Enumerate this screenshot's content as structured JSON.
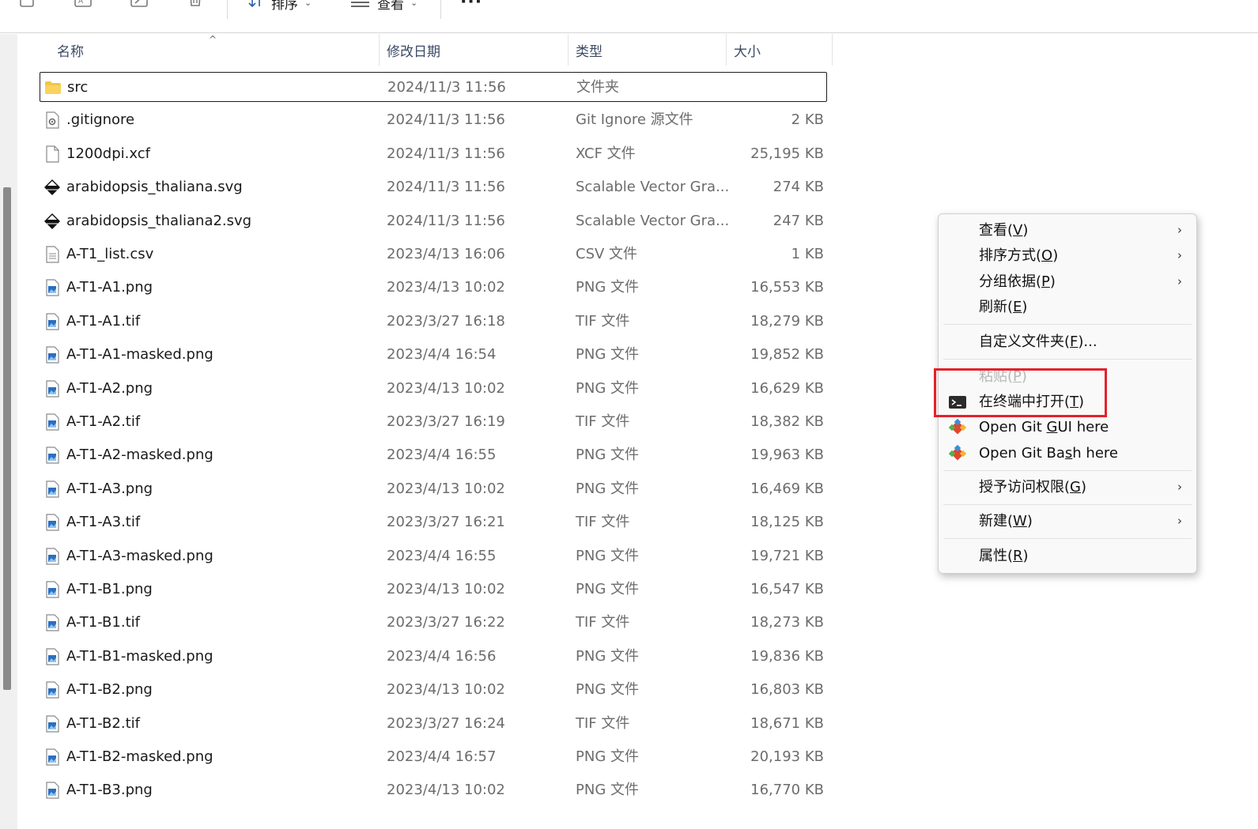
{
  "toolbar": {
    "sort_label": "排序",
    "view_label": "查看",
    "more_label": "···",
    "chevron": "⌄"
  },
  "columns": {
    "name": "名称",
    "date": "修改日期",
    "type": "类型",
    "size": "大小",
    "sort_indicator": "^"
  },
  "files": [
    {
      "name": "src",
      "date": "2024/11/3 11:56",
      "type": "文件夹",
      "size": "",
      "icon": "folder-icon",
      "selected": true
    },
    {
      "name": ".gitignore",
      "date": "2024/11/3 11:56",
      "type": "Git Ignore 源文件",
      "size": "2 KB",
      "icon": "config-file-icon"
    },
    {
      "name": "1200dpi.xcf",
      "date": "2024/11/3 11:56",
      "type": "XCF 文件",
      "size": "25,195 KB",
      "icon": "blank-file-icon"
    },
    {
      "name": "arabidopsis_thaliana.svg",
      "date": "2024/11/3 11:56",
      "type": "Scalable Vector Gra...",
      "size": "274 KB",
      "icon": "inkscape-icon"
    },
    {
      "name": "arabidopsis_thaliana2.svg",
      "date": "2024/11/3 11:56",
      "type": "Scalable Vector Gra...",
      "size": "247 KB",
      "icon": "inkscape-icon"
    },
    {
      "name": "A-T1_list.csv",
      "date": "2023/4/13 16:06",
      "type": "CSV 文件",
      "size": "1 KB",
      "icon": "text-file-icon"
    },
    {
      "name": "A-T1-A1.png",
      "date": "2023/4/13 10:02",
      "type": "PNG 文件",
      "size": "16,553 KB",
      "icon": "image-file-icon"
    },
    {
      "name": "A-T1-A1.tif",
      "date": "2023/3/27 16:18",
      "type": "TIF 文件",
      "size": "18,279 KB",
      "icon": "image-file-icon"
    },
    {
      "name": "A-T1-A1-masked.png",
      "date": "2023/4/4 16:54",
      "type": "PNG 文件",
      "size": "19,852 KB",
      "icon": "image-file-icon"
    },
    {
      "name": "A-T1-A2.png",
      "date": "2023/4/13 10:02",
      "type": "PNG 文件",
      "size": "16,629 KB",
      "icon": "image-file-icon"
    },
    {
      "name": "A-T1-A2.tif",
      "date": "2023/3/27 16:19",
      "type": "TIF 文件",
      "size": "18,382 KB",
      "icon": "image-file-icon"
    },
    {
      "name": "A-T1-A2-masked.png",
      "date": "2023/4/4 16:55",
      "type": "PNG 文件",
      "size": "19,963 KB",
      "icon": "image-file-icon"
    },
    {
      "name": "A-T1-A3.png",
      "date": "2023/4/13 10:02",
      "type": "PNG 文件",
      "size": "16,469 KB",
      "icon": "image-file-icon"
    },
    {
      "name": "A-T1-A3.tif",
      "date": "2023/3/27 16:21",
      "type": "TIF 文件",
      "size": "18,125 KB",
      "icon": "image-file-icon"
    },
    {
      "name": "A-T1-A3-masked.png",
      "date": "2023/4/4 16:55",
      "type": "PNG 文件",
      "size": "19,721 KB",
      "icon": "image-file-icon"
    },
    {
      "name": "A-T1-B1.png",
      "date": "2023/4/13 10:02",
      "type": "PNG 文件",
      "size": "16,547 KB",
      "icon": "image-file-icon"
    },
    {
      "name": "A-T1-B1.tif",
      "date": "2023/3/27 16:22",
      "type": "TIF 文件",
      "size": "18,273 KB",
      "icon": "image-file-icon"
    },
    {
      "name": "A-T1-B1-masked.png",
      "date": "2023/4/4 16:56",
      "type": "PNG 文件",
      "size": "19,836 KB",
      "icon": "image-file-icon"
    },
    {
      "name": "A-T1-B2.png",
      "date": "2023/4/13 10:02",
      "type": "PNG 文件",
      "size": "16,803 KB",
      "icon": "image-file-icon"
    },
    {
      "name": "A-T1-B2.tif",
      "date": "2023/3/27 16:24",
      "type": "TIF 文件",
      "size": "18,671 KB",
      "icon": "image-file-icon"
    },
    {
      "name": "A-T1-B2-masked.png",
      "date": "2023/4/4 16:57",
      "type": "PNG 文件",
      "size": "20,193 KB",
      "icon": "image-file-icon"
    },
    {
      "name": "A-T1-B3.png",
      "date": "2023/4/13 10:02",
      "type": "PNG 文件",
      "size": "16,770 KB",
      "icon": "image-file-icon"
    }
  ],
  "context_menu": {
    "submenu_arrow": "›",
    "view": {
      "text": "查看(",
      "key": "V",
      "tail": ")"
    },
    "sort_by": {
      "text": "排序方式(",
      "key": "O",
      "tail": ")"
    },
    "group_by": {
      "text": "分组依据(",
      "key": "P",
      "tail": ")"
    },
    "refresh": {
      "text": "刷新(",
      "key": "E",
      "tail": ")"
    },
    "customize": {
      "text": "自定义文件夹(",
      "key": "F",
      "tail": ")..."
    },
    "paste": {
      "text": "粘贴(",
      "key": "P",
      "tail": ")"
    },
    "open_terminal": {
      "text": "在终端中打开(",
      "key": "T",
      "tail": ")"
    },
    "git_gui": {
      "text": "Open Git ",
      "key": "G",
      "tail": "UI here"
    },
    "git_bash": {
      "text": "Open Git Ba",
      "key": "s",
      "tail": "h here"
    },
    "give_access": {
      "text": "授予访问权限(",
      "key": "G",
      "tail": ")"
    },
    "new": {
      "text": "新建(",
      "key": "W",
      "tail": ")"
    },
    "properties": {
      "text": "属性(",
      "key": "R",
      "tail": ")"
    }
  },
  "colors": {
    "highlight": "#e4212b",
    "folder": "#f3c640",
    "git_diamond": "#e2462d"
  }
}
